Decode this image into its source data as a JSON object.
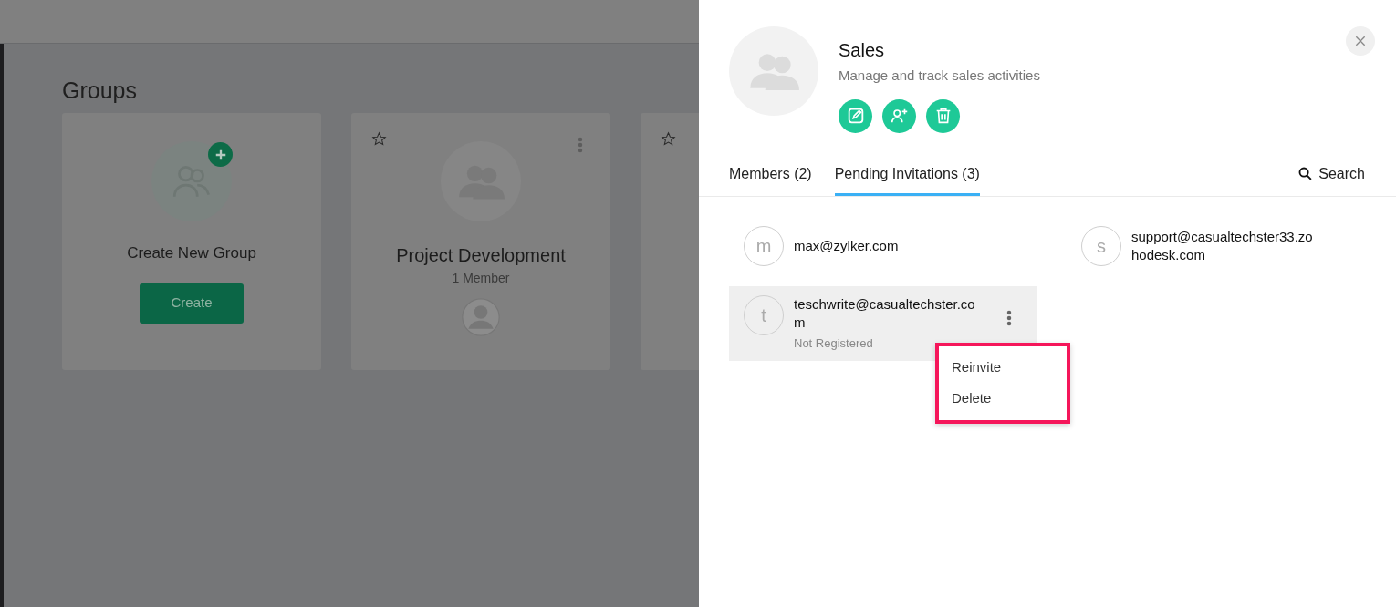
{
  "page": {
    "title": "Groups",
    "cards": [
      {
        "kind": "create",
        "title": "Create New Group",
        "button": "Create"
      },
      {
        "kind": "group",
        "title": "Project Development",
        "subtitle": "1 Member",
        "starred": false
      },
      {
        "kind": "group",
        "starred": false
      }
    ]
  },
  "panel": {
    "title": "Sales",
    "description": "Manage and track sales activities",
    "tabs": [
      {
        "label": "Members (2)",
        "selected": false
      },
      {
        "label": "Pending Invitations (3)",
        "selected": true
      }
    ],
    "search": "Search",
    "invitations": [
      {
        "initial": "m",
        "email": "max@zylker.com",
        "highlighted": false
      },
      {
        "initial": "s",
        "email": "support@casualtechster33.zohodesk.com",
        "highlighted": false
      },
      {
        "initial": "t",
        "email": "teschwrite@casualtechster.com",
        "status": "Not Registered",
        "highlighted": true,
        "menu": {
          "outlined": true,
          "items": [
            "Reinvite",
            "Delete"
          ]
        }
      }
    ]
  }
}
